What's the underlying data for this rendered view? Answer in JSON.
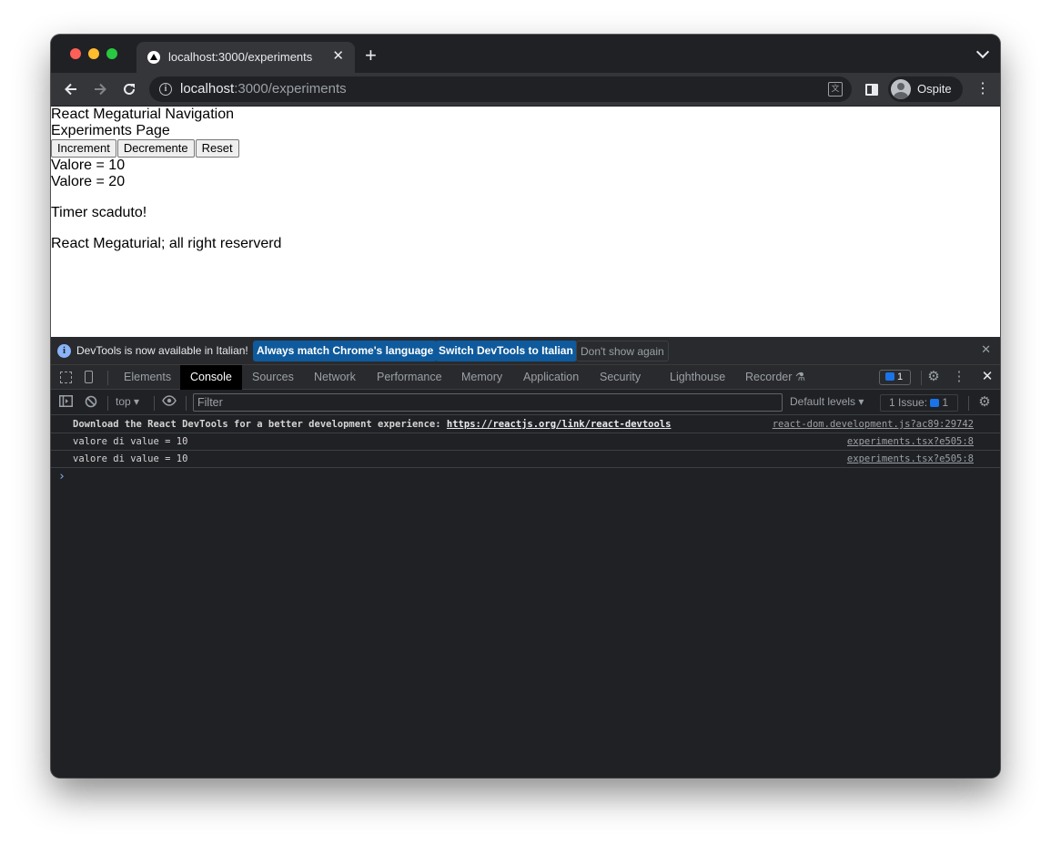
{
  "browser": {
    "tab_title": "localhost:3000/experiments",
    "tab_close": "✕",
    "new_tab": "+",
    "url_host": "localhost",
    "url_rest": ":3000/experiments",
    "profile_name": "Ospite"
  },
  "page": {
    "nav_title": "React Megaturial Navigation",
    "page_title": "Experiments Page",
    "buttons": [
      "Increment",
      "Decremente",
      "Reset"
    ],
    "value_lines": [
      "Valore = 10",
      "Valore = 20"
    ],
    "timer_text": "Timer scaduto!",
    "footer": "React Megaturial; all right reserverd"
  },
  "devtools": {
    "infobar": {
      "message": "DevTools is now available in Italian!",
      "match_button": "Always match Chrome's language",
      "switch_button": "Switch DevTools to Italian",
      "dismiss_button": "Don't show again"
    },
    "tabs": [
      "Elements",
      "Console",
      "Sources",
      "Network",
      "Performance",
      "Memory",
      "Application",
      "Security",
      "Lighthouse",
      "Recorder"
    ],
    "active_tab": "Console",
    "issues_badge_count": "1",
    "console_toolbar": {
      "context": "top",
      "filter_placeholder": "Filter",
      "levels": "Default levels",
      "issues_label": "1 Issue:",
      "issues_count": "1"
    },
    "messages": [
      {
        "text": "Download the React DevTools for a better development experience: ",
        "link": "https://reactjs.org/link/react-devtools",
        "source": "react-dom.development.js?ac89:29742"
      },
      {
        "text": "valore di value = 10",
        "source": "experiments.tsx?e505:8"
      },
      {
        "text": "valore di value = 10",
        "source": "experiments.tsx?e505:8"
      }
    ],
    "prompt": "›"
  },
  "colors": {
    "accent_button": "#0e5a9c",
    "prompt": "#8ab4f8",
    "active_tab_bg": "#000000"
  }
}
